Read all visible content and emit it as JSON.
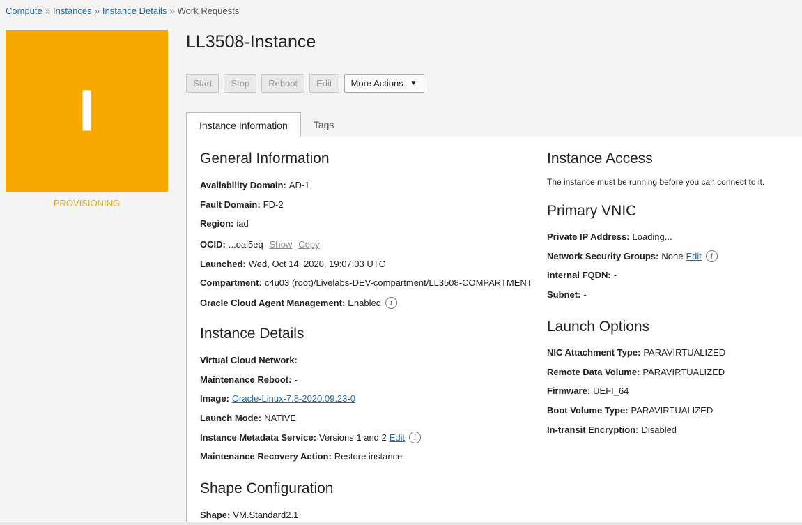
{
  "breadcrumb": [
    {
      "label": "Compute",
      "link": true
    },
    {
      "label": "Instances",
      "link": true
    },
    {
      "label": "Instance Details",
      "link": true
    },
    {
      "label": "Work Requests",
      "link": false
    }
  ],
  "breadcrumb_sep": "»",
  "tile": {
    "glyph": "I",
    "status": "PROVISIONING",
    "color": "#f5a800"
  },
  "title": "LL3508-Instance",
  "actions": {
    "start": "Start",
    "stop": "Stop",
    "reboot": "Reboot",
    "edit": "Edit",
    "more": "More Actions",
    "more_caret": "▼"
  },
  "tabs": {
    "info": "Instance Information",
    "tags": "Tags"
  },
  "general": {
    "title": "General Information",
    "availability_domain": {
      "k": "Availability Domain:",
      "v": "AD-1"
    },
    "fault_domain": {
      "k": "Fault Domain:",
      "v": "FD-2"
    },
    "region": {
      "k": "Region:",
      "v": "iad"
    },
    "ocid": {
      "k": "OCID:",
      "v": "...oal5eq",
      "show": "Show",
      "copy": "Copy"
    },
    "launched": {
      "k": "Launched:",
      "v": "Wed, Oct 14, 2020, 19:07:03 UTC"
    },
    "compartment": {
      "k": "Compartment:",
      "v": "c4u03 (root)/Livelabs-DEV-compartment/LL3508-COMPARTMENT"
    },
    "agent": {
      "k": "Oracle Cloud Agent Management:",
      "v": "Enabled"
    }
  },
  "details": {
    "title": "Instance Details",
    "vcn": {
      "k": "Virtual Cloud Network:",
      "v": ""
    },
    "maintenance_reboot": {
      "k": "Maintenance Reboot:",
      "v": "-"
    },
    "image": {
      "k": "Image:",
      "v": "Oracle-Linux-7.8-2020.09.23-0"
    },
    "launch_mode": {
      "k": "Launch Mode:",
      "v": "NATIVE"
    },
    "metadata_service": {
      "k": "Instance Metadata Service:",
      "v": "Versions 1 and 2",
      "edit": "Edit"
    },
    "recovery_action": {
      "k": "Maintenance Recovery Action:",
      "v": "Restore instance"
    }
  },
  "shape": {
    "title": "Shape Configuration",
    "shape": {
      "k": "Shape:",
      "v": "VM.Standard2.1"
    }
  },
  "access": {
    "title": "Instance Access",
    "note": "The instance must be running before you can connect to it."
  },
  "vnic": {
    "title": "Primary VNIC",
    "private_ip": {
      "k": "Private IP Address:",
      "v": "Loading..."
    },
    "nsg": {
      "k": "Network Security Groups:",
      "v": "None",
      "edit": "Edit"
    },
    "fqdn": {
      "k": "Internal FQDN:",
      "v": "-"
    },
    "subnet": {
      "k": "Subnet:",
      "v": "-"
    }
  },
  "launch": {
    "title": "Launch Options",
    "nic": {
      "k": "NIC Attachment Type:",
      "v": "PARAVIRTUALIZED"
    },
    "remote_volume": {
      "k": "Remote Data Volume:",
      "v": "PARAVIRTUALIZED"
    },
    "firmware": {
      "k": "Firmware:",
      "v": "UEFI_64"
    },
    "boot_volume": {
      "k": "Boot Volume Type:",
      "v": "PARAVIRTUALIZED"
    },
    "encryption": {
      "k": "In-transit Encryption:",
      "v": "Disabled"
    }
  },
  "info_icon_glyph": "i"
}
